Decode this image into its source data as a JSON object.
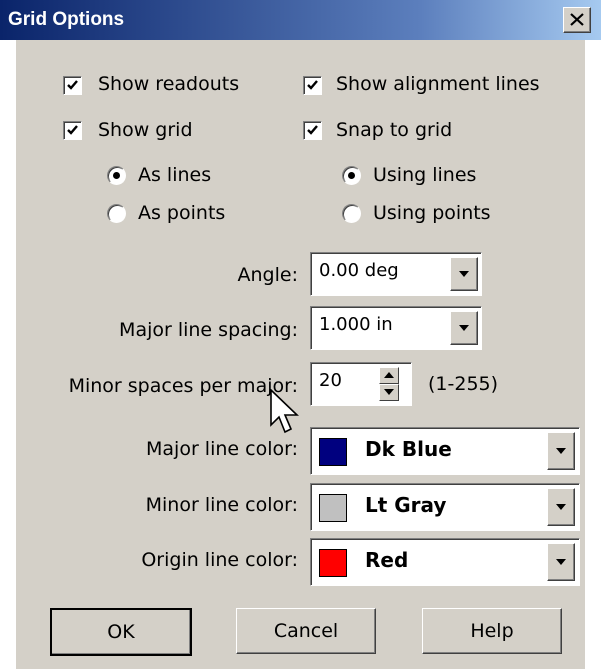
{
  "window": {
    "title": "Grid Options"
  },
  "options": {
    "show_readouts": {
      "label": "Show readouts",
      "checked": true
    },
    "show_alignment_lines": {
      "label": "Show alignment lines",
      "checked": true
    },
    "show_grid": {
      "label": "Show grid",
      "checked": true
    },
    "snap_to_grid": {
      "label": "Snap to grid",
      "checked": true
    },
    "grid_style": {
      "as_lines": "As lines",
      "as_points": "As points",
      "selected": "As lines"
    },
    "snap_style": {
      "using_lines": "Using lines",
      "using_points": "Using points",
      "selected": "Using lines"
    }
  },
  "fields": {
    "angle": {
      "label": "Angle:",
      "value": "0.00 deg"
    },
    "major_spacing": {
      "label": "Major line spacing:",
      "value": "1.000 in"
    },
    "minor_spaces": {
      "label": "Minor spaces per major:",
      "value": "20",
      "range": "(1-255)"
    },
    "major_color": {
      "label": "Major line color:",
      "value": "Dk Blue",
      "swatch": "#00007f"
    },
    "minor_color": {
      "label": "Minor line color:",
      "value": "Lt Gray",
      "swatch": "#c0c0c0"
    },
    "origin_color": {
      "label": "Origin line color:",
      "value": "Red",
      "swatch": "#ff0000"
    }
  },
  "buttons": {
    "ok": "OK",
    "cancel": "Cancel",
    "help": "Help"
  },
  "colors": {
    "title_bar": "#0a246a",
    "dialog_bg": "#d4d0c8"
  }
}
